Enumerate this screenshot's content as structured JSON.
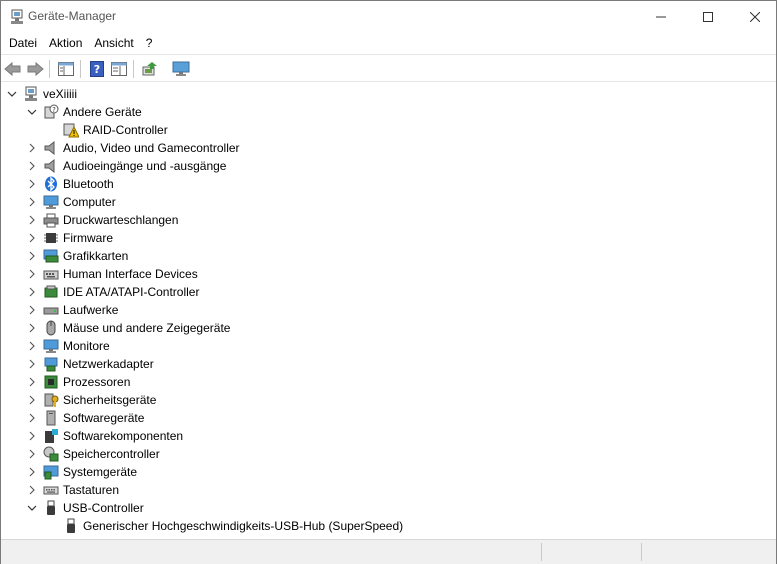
{
  "window": {
    "title": "Geräte-Manager"
  },
  "menu": [
    "Datei",
    "Aktion",
    "Ansicht",
    "?"
  ],
  "tree": {
    "root": "veXiiiii",
    "items": [
      {
        "label": "Andere Geräte",
        "expanded": true,
        "icon": "other-devices-icon",
        "children": [
          {
            "label": "RAID-Controller",
            "icon": "warning-device-icon"
          }
        ]
      },
      {
        "label": "Audio, Video und Gamecontroller",
        "icon": "speaker-icon"
      },
      {
        "label": "Audioeingänge und -ausgänge",
        "icon": "speaker-icon"
      },
      {
        "label": "Bluetooth",
        "icon": "bluetooth-icon"
      },
      {
        "label": "Computer",
        "icon": "computer-icon"
      },
      {
        "label": "Druckwarteschlangen",
        "icon": "printer-icon"
      },
      {
        "label": "Firmware",
        "icon": "chip-icon"
      },
      {
        "label": "Grafikkarten",
        "icon": "display-adapter-icon"
      },
      {
        "label": "Human Interface Devices",
        "icon": "hid-icon"
      },
      {
        "label": "IDE ATA/ATAPI-Controller",
        "icon": "ide-icon"
      },
      {
        "label": "Laufwerke",
        "icon": "drive-icon"
      },
      {
        "label": "Mäuse und andere Zeigegeräte",
        "icon": "mouse-icon"
      },
      {
        "label": "Monitore",
        "icon": "monitor-icon"
      },
      {
        "label": "Netzwerkadapter",
        "icon": "network-icon"
      },
      {
        "label": "Prozessoren",
        "icon": "processor-icon"
      },
      {
        "label": "Sicherheitsgeräte",
        "icon": "security-icon"
      },
      {
        "label": "Softwaregeräte",
        "icon": "software-device-icon"
      },
      {
        "label": "Softwarekomponenten",
        "icon": "software-component-icon"
      },
      {
        "label": "Speichercontroller",
        "icon": "storage-icon"
      },
      {
        "label": "Systemgeräte",
        "icon": "system-icon"
      },
      {
        "label": "Tastaturen",
        "icon": "keyboard-icon"
      },
      {
        "label": "USB-Controller",
        "expanded": true,
        "icon": "usb-icon",
        "children": [
          {
            "label": "Generischer Hochgeschwindigkeits-USB-Hub (SuperSpeed)",
            "icon": "usb-icon"
          }
        ]
      }
    ]
  }
}
